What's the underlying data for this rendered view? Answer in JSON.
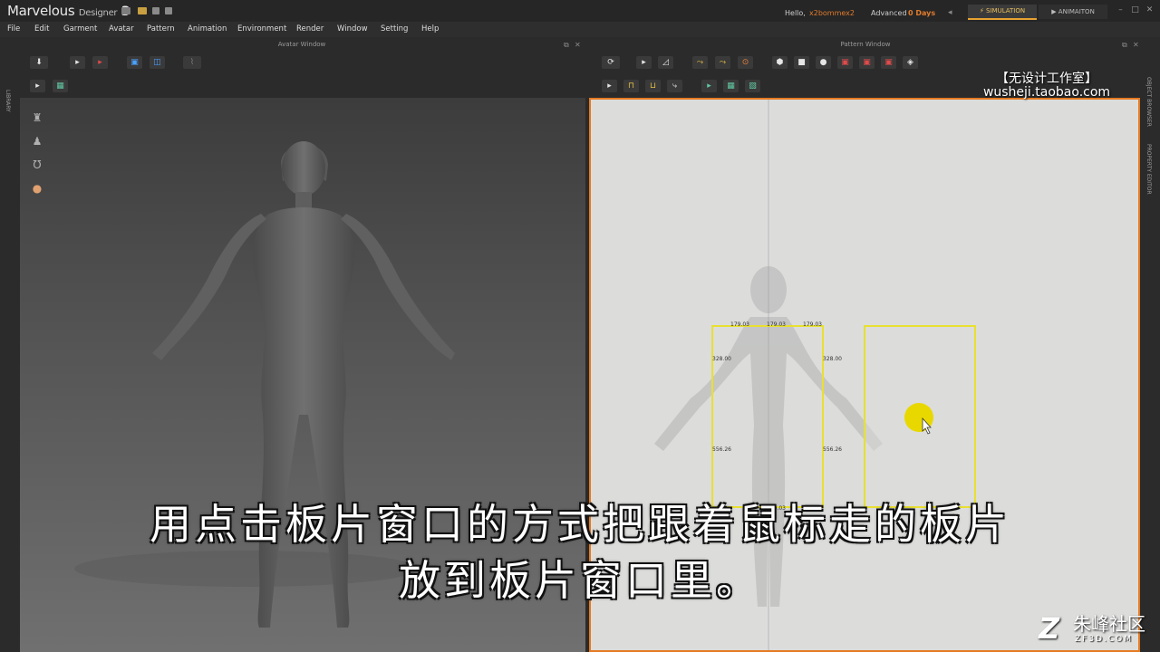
{
  "app": {
    "name": "Marvelous",
    "name_small": "Designer",
    "version": "3"
  },
  "header": {
    "hello": "Hello,",
    "user": "x2bommex2",
    "edition": "Advanced",
    "days": "0 Days",
    "tab_simulation": "SIMULATION",
    "tab_animation": "ANIMAITON"
  },
  "menu": {
    "items": [
      "File",
      "Edit",
      "Garment",
      "Avatar",
      "Pattern",
      "Animation",
      "Environment",
      "Render",
      "Window",
      "Setting",
      "Help"
    ]
  },
  "panels": {
    "avatar_window": "Avatar Window",
    "pattern_window": "Pattern Window",
    "library": "LIBRARY",
    "object_browser": "OBJECT BROWSER",
    "property_editor": "PROPERTY EDITOR"
  },
  "pattern": {
    "labels": [
      "179.03",
      "179.03",
      "179.03",
      "328.00",
      "328.00",
      "556.26",
      "556.26",
      "179.03"
    ]
  },
  "overlay": {
    "watermark_line1": "【无设计工作室】",
    "watermark_line2": "wusheji.taobao.com",
    "subtitle_line1": "用点击板片窗口的方式把跟着鼠标走的板片",
    "subtitle_line2": "放到板片窗口里。",
    "brand_cn": "朱峰社区",
    "brand_url": "ZF3D.COM",
    "brand_mark": "Z"
  },
  "colors": {
    "accent": "#e57a22",
    "selection": "#e8e030",
    "cursor": "#e8d800"
  },
  "icons": {
    "pointer": "cursor-pointer-icon",
    "highlight": "yellow-cursor-highlight"
  }
}
